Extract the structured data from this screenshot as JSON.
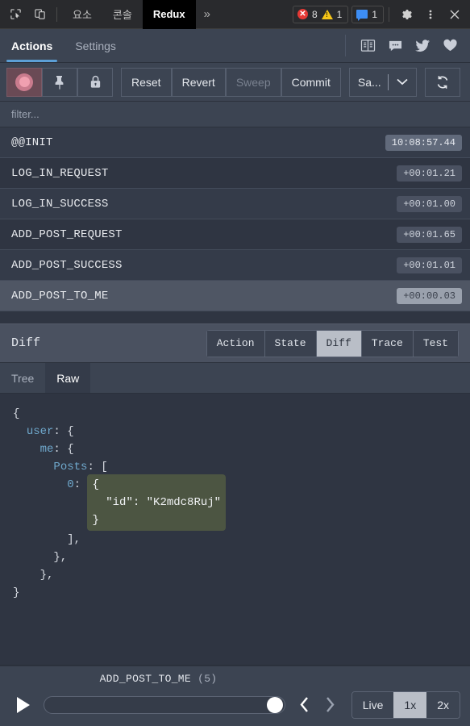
{
  "devtools": {
    "icons": [
      {
        "name": "inspect-element-icon"
      },
      {
        "name": "device-toolbar-icon"
      }
    ],
    "tabs": [
      {
        "label": "요소",
        "active": false
      },
      {
        "label": "콘솔",
        "active": false
      },
      {
        "label": "Redux",
        "active": true
      }
    ],
    "more_label": "»",
    "error_count": "8",
    "warning_count": "1",
    "message_count": "1",
    "settings_icon": "gear-icon",
    "kebab_icon": "more-vertical-icon",
    "close_icon": "close-icon",
    "error_mark": "✕"
  },
  "redux_tabs": {
    "items": [
      {
        "label": "Actions",
        "active": true
      },
      {
        "label": "Settings",
        "active": false
      }
    ],
    "link_icons": [
      "book-icon",
      "chat-icon",
      "twitter-icon",
      "heart-icon"
    ]
  },
  "toolbar": {
    "record_label": "record-toggle",
    "pin_label": "pin-toggle",
    "lock_label": "lock-toggle",
    "reset_label": "Reset",
    "revert_label": "Revert",
    "sweep_label": "Sweep",
    "commit_label": "Commit",
    "save_label": "Sa...",
    "dropdown_icon": "chevron-down-icon",
    "refresh_icon": "refresh-icon"
  },
  "filter": {
    "placeholder": "filter...",
    "value": ""
  },
  "actions": {
    "rows": [
      {
        "name": "@@INIT",
        "time": "10:08:57.44",
        "style": "light",
        "selected": false
      },
      {
        "name": "LOG_IN_REQUEST",
        "time": "+00:01.21",
        "style": "normal",
        "selected": false
      },
      {
        "name": "LOG_IN_SUCCESS",
        "time": "+00:01.00",
        "style": "normal",
        "selected": false
      },
      {
        "name": "ADD_POST_REQUEST",
        "time": "+00:01.65",
        "style": "normal",
        "selected": false
      },
      {
        "name": "ADD_POST_SUCCESS",
        "time": "+00:01.01",
        "style": "normal",
        "selected": false
      },
      {
        "name": "ADD_POST_TO_ME",
        "time": "+00:00.03",
        "style": "sel",
        "selected": true
      }
    ]
  },
  "inspector": {
    "title": "Diff",
    "tabs": [
      {
        "label": "Action",
        "active": false
      },
      {
        "label": "State",
        "active": false
      },
      {
        "label": "Diff",
        "active": true
      },
      {
        "label": "Trace",
        "active": false
      },
      {
        "label": "Test",
        "active": false
      }
    ],
    "subtabs": [
      {
        "label": "Tree",
        "active": false
      },
      {
        "label": "Raw",
        "active": true
      }
    ]
  },
  "code": {
    "line1": "{",
    "line2_key": "user",
    "line2_rest": ": {",
    "line3_key": "me",
    "line3_rest": ": {",
    "line4_key": "Posts",
    "line4_rest": ": [",
    "line5_key": "0",
    "line5_rest": ": ",
    "diff_line1": "{",
    "diff_line2": "  \"id\": \"K2mdc8Ruj\"",
    "diff_line3": "}",
    "line6": "        ],",
    "line7": "      },",
    "line8": "    },",
    "line9": "}"
  },
  "player": {
    "current_action": "ADD_POST_TO_ME",
    "count_label": "(5)",
    "play_icon": "play-icon",
    "prev_icon": "chevron-left-icon",
    "next_icon": "chevron-right-icon",
    "slider_value": "100",
    "speeds": [
      {
        "label": "Live",
        "active": false
      },
      {
        "label": "1x",
        "active": true
      },
      {
        "label": "2x",
        "active": false
      }
    ]
  },
  "colors": {
    "panel_bg": "#2f3542",
    "bar_bg": "#3c4452",
    "accent_blue": "#5c9fd6",
    "diff_added": "#4c5542",
    "key_blue": "#6fa8cc",
    "error_red": "#e53935",
    "warn_yellow": "#f5c518",
    "message_blue": "#3d8ef5"
  }
}
